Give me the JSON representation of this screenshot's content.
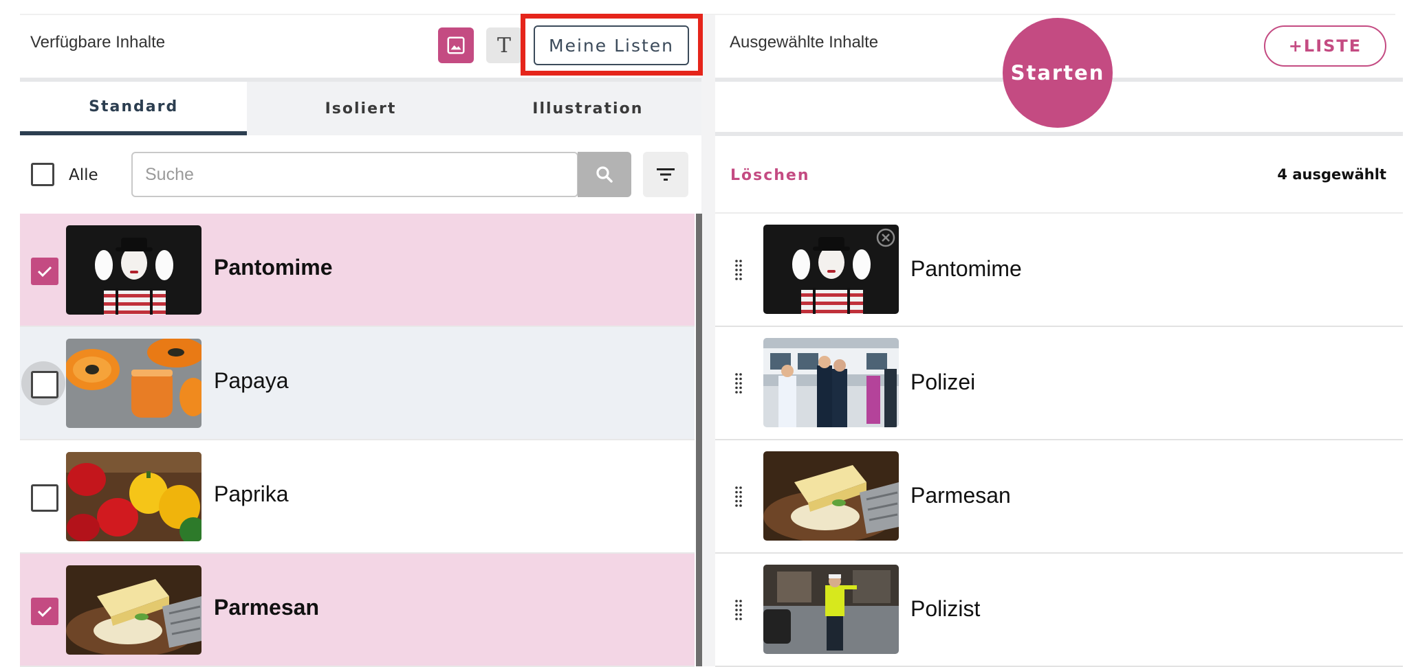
{
  "colors": {
    "accent": "#c44b82",
    "highlight": "#e5251b",
    "tab_active": "#2c3e50",
    "selected_row": "#f3d6e5"
  },
  "left_panel": {
    "title": "Verfügbare Inhalte",
    "image_mode_icon": "image-icon",
    "text_mode_icon": "text-icon",
    "text_mode_glyph": "T",
    "my_lists_button": "Meine Listen",
    "tabs": [
      {
        "label": "Standard",
        "active": true
      },
      {
        "label": "Isoliert",
        "active": false
      },
      {
        "label": "Illustration",
        "active": false
      }
    ],
    "select_all_label": "Alle",
    "search": {
      "placeholder": "Suche",
      "value": ""
    },
    "items": [
      {
        "label": "Pantomime",
        "checked": true,
        "image": "mime-photo"
      },
      {
        "label": "Papaya",
        "checked": false,
        "image": "papaya-photo"
      },
      {
        "label": "Paprika",
        "checked": false,
        "image": "paprika-photo"
      },
      {
        "label": "Parmesan",
        "checked": true,
        "image": "parmesan-photo"
      }
    ]
  },
  "right_panel": {
    "title": "Ausgewählte Inhalte",
    "start_button": "Starten",
    "add_list_button": "+LISTE",
    "delete_label": "Löschen",
    "selected_count": "4 ausgewählt",
    "items": [
      {
        "label": "Pantomime",
        "image": "mime-photo"
      },
      {
        "label": "Polizei",
        "image": "police-photo"
      },
      {
        "label": "Parmesan",
        "image": "parmesan-photo"
      },
      {
        "label": "Polizist",
        "image": "policeman-photo"
      }
    ]
  }
}
